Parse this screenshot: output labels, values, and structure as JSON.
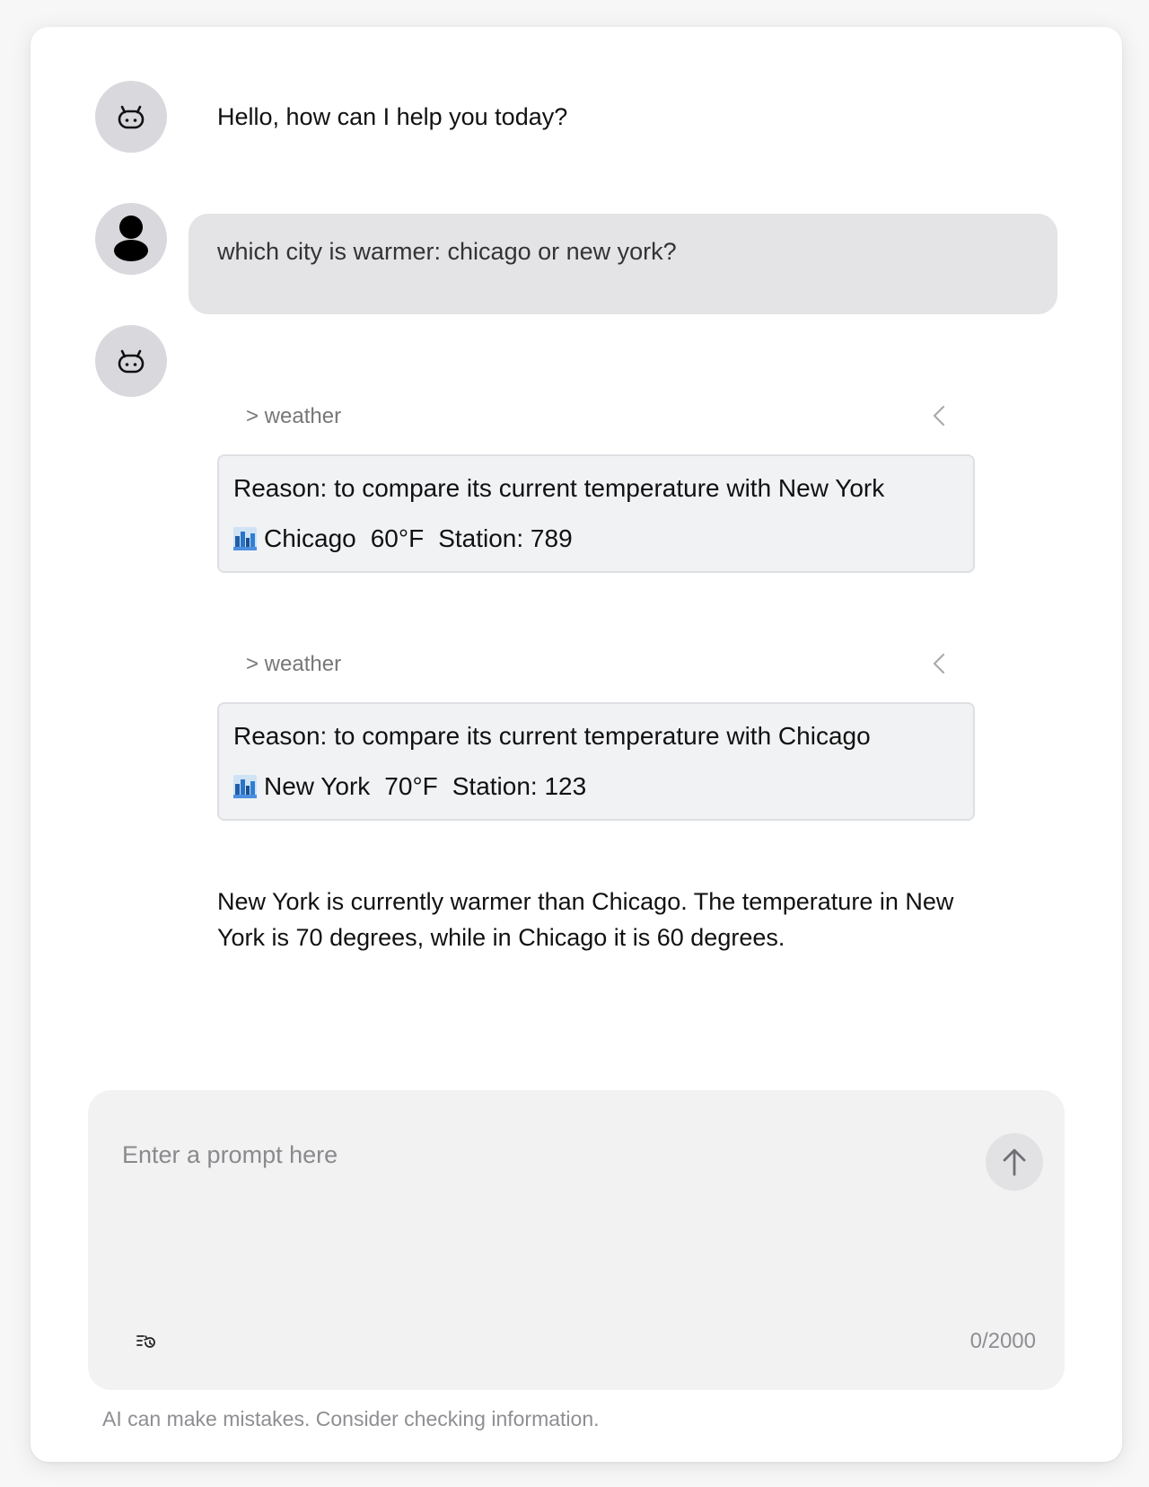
{
  "messages": {
    "greeting": "Hello, how can I help you today?",
    "user_question": "which city is warmer: chicago or new york?",
    "answer": "New York is currently warmer than Chicago. The temperature in New York is 70 degrees, while in Chicago it is 60 degrees."
  },
  "tool_calls": [
    {
      "label": "> weather",
      "reason": "Reason: to compare its current temperature with New York",
      "city": "Chicago",
      "temp": "60°F",
      "station": "Station: 789"
    },
    {
      "label": "> weather",
      "reason": "Reason: to compare its current temperature with Chicago",
      "city": "New York",
      "temp": "70°F",
      "station": "Station: 123"
    }
  ],
  "composer": {
    "placeholder": "Enter a prompt here",
    "counter": "0/2000"
  },
  "disclaimer": "AI can make mistakes. Consider checking information.",
  "icons": {
    "bot": "bot-icon",
    "user": "user-icon",
    "collapse": "chevron-left-icon",
    "city": "cityscape-icon",
    "send": "arrow-up-icon",
    "history": "history-icon"
  }
}
